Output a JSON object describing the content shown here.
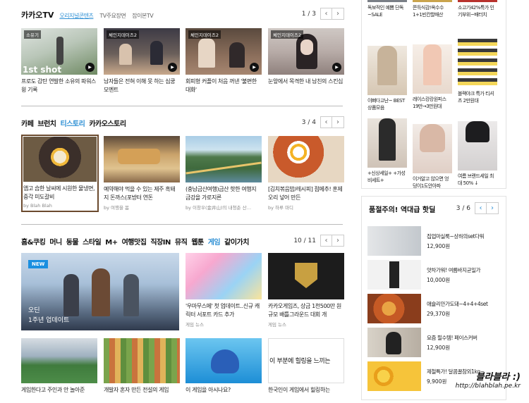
{
  "kakaotv": {
    "tabs": [
      "카카오TV",
      "오리지널콘텐츠",
      "TV주요장면",
      "잡이본TV"
    ],
    "page": "1 / 3",
    "items": [
      {
        "badge": "소유기",
        "overlay": "1st shot",
        "title": "프로도 감탄 연발한 소유의 파워스윙 기록"
      },
      {
        "badge": "체인지데이즈2",
        "title": "남자들은 전혀 이해 못 하는 심쿵 모멘트"
      },
      {
        "badge": "체인지데이즈2",
        "title": "회피형 커플이 처음 꺼낸 '불편한 대화'"
      },
      {
        "badge": "체인지데이즈2",
        "title": "눈앞에서 목격한 내 남친의 스킨십"
      }
    ]
  },
  "cafe": {
    "tabs": [
      "카페",
      "브런치",
      "티스토리",
      "카카오스토리"
    ],
    "page": "3 / 4",
    "items": [
      {
        "title": "앱고 습한 날씨에 시원한 물냉면, 중각 미도갈비",
        "src": "by Blah Blah"
      },
      {
        "title": "예약해야 먹을 수 있는 제주 흑돼지 돈까스(포방터 연돈",
        "src": "by 여행을 봄"
      },
      {
        "title": "(충남금산여행)금산 핫한 여행지 금강을 가로지른",
        "src": "by 이창우(金井山)의 내청춘 산…"
      },
      {
        "title": "[김치볶음밥/레시피] 점메추! 훈제오리 넣어 만든",
        "src": "by 하루 마디"
      }
    ]
  },
  "hobby": {
    "tabs": [
      "홈&쿠킹",
      "머니",
      "동물",
      "스타일",
      "M+",
      "여행맛집",
      "직장IN",
      "뮤직",
      "웹툰",
      "게임",
      "같이가치"
    ],
    "page": "10 / 11",
    "feature": {
      "badge": "NEW",
      "line1": "오딘",
      "line2": "1주년 업데이트"
    },
    "items": [
      {
        "title": "'우마무스메' 첫 업데이트..신규 캐릭터 서포트 카드 추가",
        "src": "게임 뉴스"
      },
      {
        "title": "카카오게임즈, 상금 1천500만 원 규모 배틀그라운드 대회 개",
        "src": "게임 뉴스"
      }
    ],
    "row2": [
      {
        "title": "게임한다고 주인과 안 놀아준"
      },
      {
        "title": "개발자 혼자 만든 전설의 게임"
      },
      {
        "title": "이 게임을 아시나요?"
      },
      {
        "title": "한국인이 게임에서 힐링하는",
        "overlay": "이 부분에 힐링을 느끼는"
      }
    ]
  },
  "shopping": {
    "top": [
      "독보적인 예쁨 단독~SALE",
      "쫀득식감!옥수수 1+1빈칸할매산",
      "소고기42%특가 인기부위~배터치"
    ],
    "items": [
      {
        "label": "이뻐다고난~ BEST상품모음"
      },
      {
        "label": "레이스캉캉원피스 19만→3만원대"
      },
      {
        "label": "블랙야크 특가 티셔츠 2만원대"
      },
      {
        "label": "+신상세일+ +가성비세트+"
      },
      {
        "label": "이거알고 않으면 엉덩이1도안아파"
      },
      {
        "label": "여름 브랜드세일 최대 50% ↓"
      }
    ]
  },
  "hotdeal": {
    "title": "품절주의! 역대급 핫딜",
    "page": "3 / 6",
    "items": [
      {
        "name": "집업마실룩~상하의set다워",
        "price": "12,900원"
      },
      {
        "name": "얏차가워! 여름바지균일가",
        "price": "10,000원"
      },
      {
        "name": "애슐리안가도돼~4+4+4set",
        "price": "29,370원"
      },
      {
        "name": "요즘 필수템! 페이스커버",
        "price": "12,900원"
      },
      {
        "name": "제철특가! 달콤꿀참외1kg~",
        "price": "9,900원"
      }
    ]
  },
  "watermark": {
    "title": "블라블라 :)",
    "url": "http://blahblah.pe.kr"
  },
  "colors": {
    "accent": "#2d8fd4",
    "link": "#2d8fd4"
  }
}
